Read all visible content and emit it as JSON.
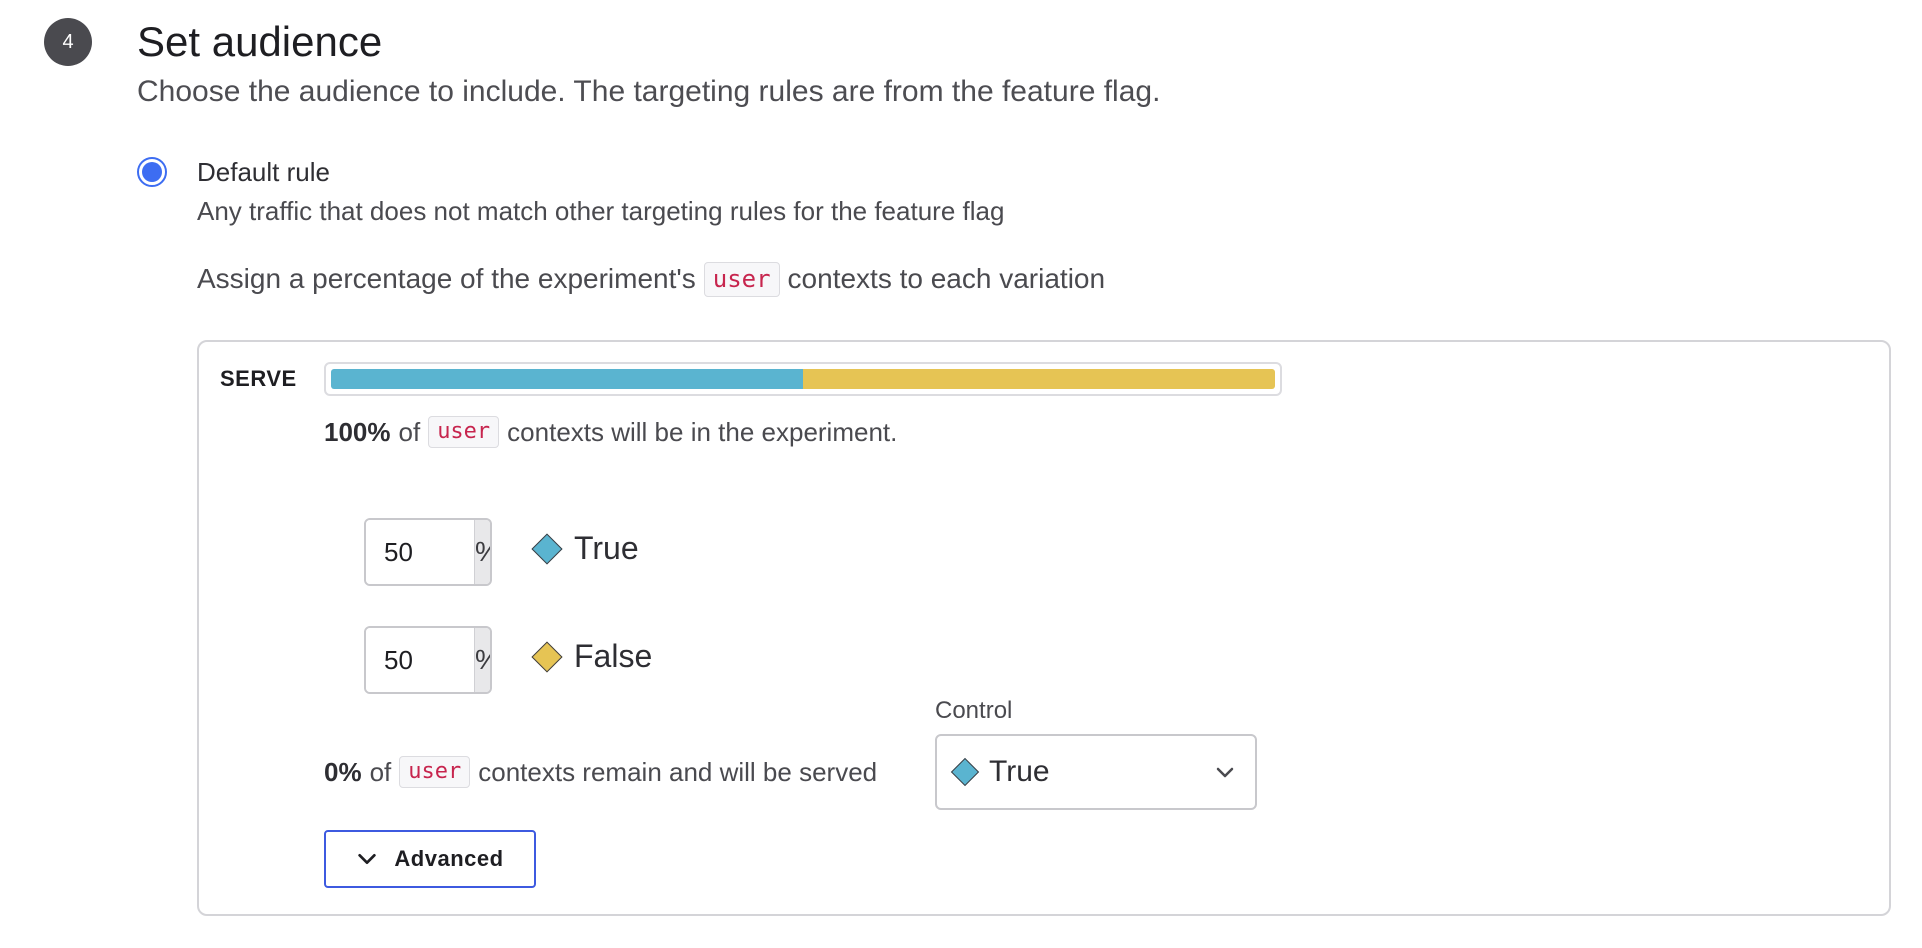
{
  "step": {
    "number": "4",
    "title": "Set audience",
    "description": "Choose the audience to include. The targeting rules are from the feature flag."
  },
  "default_rule": {
    "label": "Default rule",
    "description": "Any traffic that does not match other targeting rules for the feature flag",
    "selected": true
  },
  "assign": {
    "prefix": "Assign a percentage of the experiment's",
    "context_kind": "user",
    "suffix": "contexts to each variation"
  },
  "serve": {
    "label": "SERVE",
    "split_bar": [
      {
        "variation": "True",
        "percent": 50,
        "color": "#5ab4d0"
      },
      {
        "variation": "False",
        "percent": 50,
        "color": "#e6c454"
      }
    ],
    "included": {
      "percent": "100%",
      "of": "of",
      "context_kind": "user",
      "suffix": "contexts will be in the experiment."
    },
    "variations": [
      {
        "value": "50",
        "suffix": "%",
        "name": "True",
        "color": "#5ab4d0"
      },
      {
        "value": "50",
        "suffix": "%",
        "name": "False",
        "color": "#e6c454"
      }
    ],
    "remaining": {
      "percent": "0%",
      "of": "of",
      "context_kind": "user",
      "suffix": "contexts remain and will be served"
    },
    "control": {
      "label": "Control",
      "selected": "True",
      "color": "#5ab4d0"
    },
    "advanced_label": "Advanced"
  }
}
